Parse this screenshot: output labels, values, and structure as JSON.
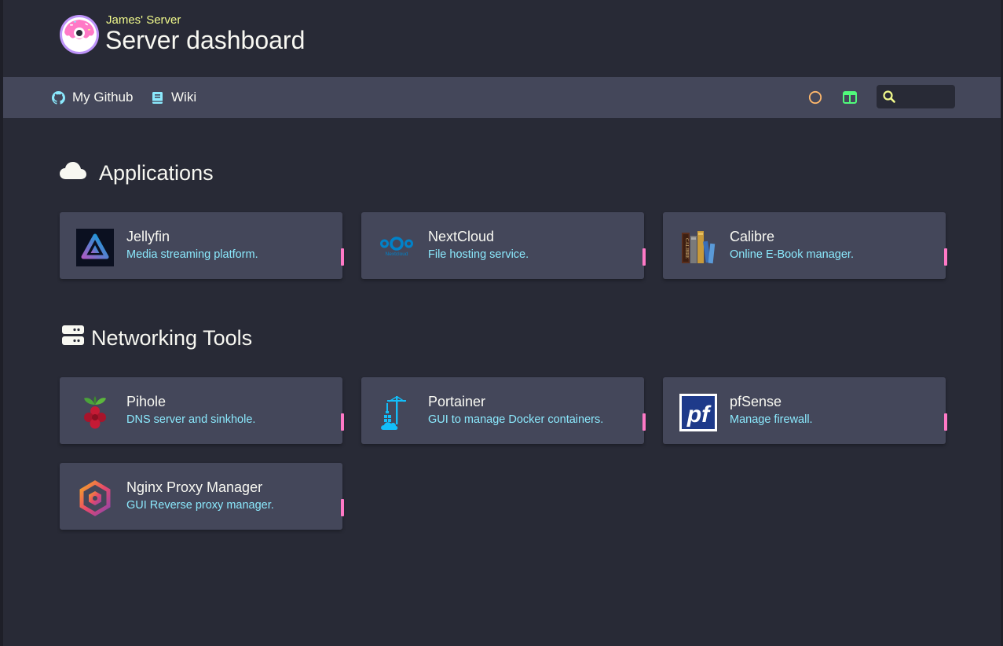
{
  "header": {
    "subtitle": "James' Server",
    "title": "Server dashboard"
  },
  "navbar": {
    "links": [
      {
        "label": "My Github",
        "icon": "github-icon"
      },
      {
        "label": "Wiki",
        "icon": "book-icon"
      }
    ],
    "search": {
      "value": "",
      "placeholder": ""
    }
  },
  "sections": [
    {
      "title": "Applications",
      "icon": "cloud-icon",
      "services": [
        {
          "name": "Jellyfin",
          "desc": "Media streaming platform.",
          "icon": "jellyfin-icon"
        },
        {
          "name": "NextCloud",
          "desc": "File hosting service.",
          "icon": "nextcloud-icon",
          "logo_text": "Nextcloud"
        },
        {
          "name": "Calibre",
          "desc": "Online E-Book manager.",
          "icon": "calibre-icon",
          "logo_text": "CALIBRE"
        }
      ]
    },
    {
      "title": "Networking Tools",
      "icon": "server-icon",
      "services": [
        {
          "name": "Pihole",
          "desc": "DNS server and sinkhole.",
          "icon": "pihole-icon"
        },
        {
          "name": "Portainer",
          "desc": "GUI to manage Docker containers.",
          "icon": "portainer-icon"
        },
        {
          "name": "pfSense",
          "desc": "Manage firewall.",
          "icon": "pfsense-icon",
          "logo_text": "pf"
        },
        {
          "name": "Nginx Proxy Manager",
          "desc": "GUI Reverse proxy manager.",
          "icon": "nginx-proxy-manager-icon"
        }
      ]
    }
  ],
  "colors": {
    "background": "#282a36",
    "surface": "#44475a",
    "text": "#f8f8f2",
    "subtitle": "#f1fa8c",
    "description": "#8be9fd",
    "tag": "#ff79c6",
    "theme_icon": "#ffb86c",
    "layout_icon": "#50fa7b",
    "search_icon": "#f1fa8c"
  }
}
